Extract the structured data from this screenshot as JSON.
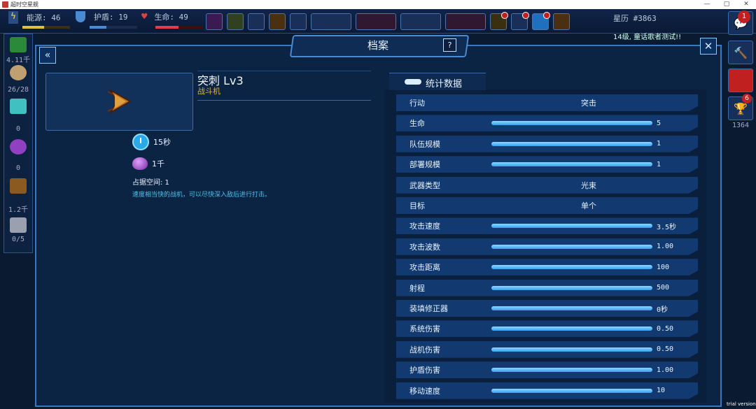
{
  "window": {
    "title": "超时空星舰",
    "controls": [
      "—",
      "▢",
      "✕"
    ]
  },
  "hud": {
    "energy": {
      "label": "能源: 46",
      "fill": 0.46
    },
    "shield": {
      "label": "护盾: 19",
      "fill": 0.35
    },
    "health": {
      "label": "生命: 49",
      "fill": 0.49
    },
    "star_calendar": "星历 #3863",
    "notice": "14级, 童话歌者测试!!",
    "notification_count": "1"
  },
  "left_rail": {
    "credits": "4.11千",
    "crew": "26/28",
    "crystals": "0",
    "orbs": "0",
    "cargo": "1.2千",
    "modules": "0/5"
  },
  "right_rail": {
    "trophy_count": "1364",
    "trophy_badge": "6"
  },
  "panel": {
    "title": "档案",
    "help_label": "?",
    "back_label": "«",
    "close_label": "✕"
  },
  "ship": {
    "name": "突刺 Lv3",
    "class": "战斗机",
    "build_time": "15秒",
    "cost": "1千",
    "space": "占据空间: 1",
    "description": "速度相当快的战机，可以尽快深入敌后进行打击。"
  },
  "stats": {
    "title": "统计数据",
    "rows": [
      {
        "label": "行动",
        "text": "突击"
      },
      {
        "label": "生命",
        "value": "5",
        "fill": 1.0
      },
      {
        "label": "队伍规模",
        "value": "1",
        "fill": 1.0
      },
      {
        "label": "部署规模",
        "value": "1",
        "fill": 1.0
      },
      {
        "label": "武器类型",
        "text": "光束"
      },
      {
        "label": "目标",
        "text": "单个"
      },
      {
        "label": "攻击速度",
        "value": "3.5秒",
        "fill": 1.0
      },
      {
        "label": "攻击波数",
        "value": "1.00",
        "fill": 1.0
      },
      {
        "label": "攻击距离",
        "value": "100",
        "fill": 1.0
      },
      {
        "label": "射程",
        "value": "500",
        "fill": 1.0
      },
      {
        "label": "装填修正器",
        "value": "0秒",
        "fill": 1.0
      },
      {
        "label": "系统伤害",
        "value": "0.50",
        "fill": 1.0
      },
      {
        "label": "战机伤害",
        "value": "0.50",
        "fill": 1.0
      },
      {
        "label": "护盾伤害",
        "value": "1.00",
        "fill": 1.0
      },
      {
        "label": "移动速度",
        "value": "10",
        "fill": 1.0
      }
    ]
  },
  "watermark": "trial version"
}
